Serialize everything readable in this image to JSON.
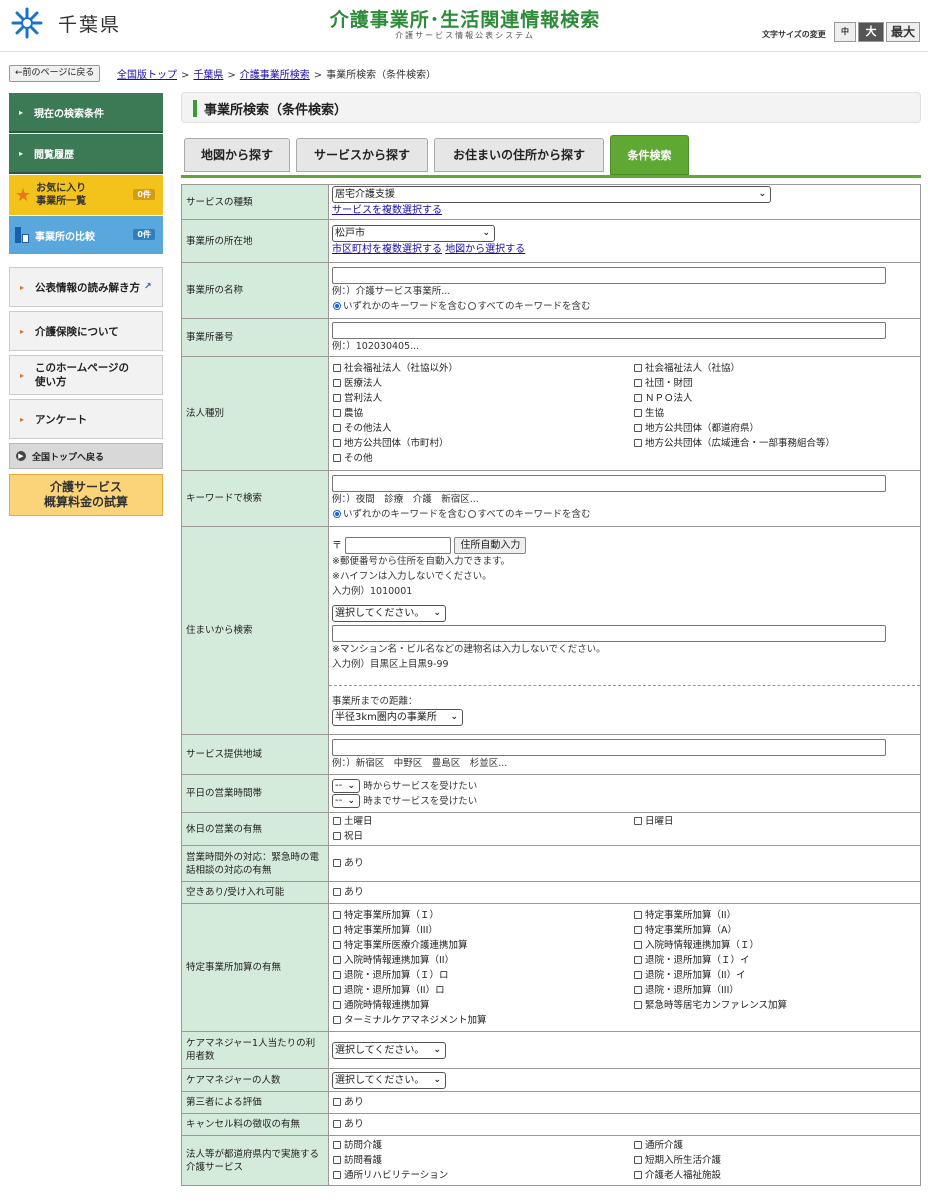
{
  "header": {
    "prefecture": "千葉県",
    "title": "介護事業所･生活関連情報検索",
    "subtitle": "介護サービス情報公表システム",
    "font_size_label": "文字サイズの変更",
    "font_sizes": [
      "中",
      "大",
      "最大"
    ],
    "brand_color": "#2e8b3a",
    "icons": {
      "logo": "chiba-logo-icon"
    }
  },
  "nav": {
    "back_button": "←前のページに戻る",
    "breadcrumb": [
      "全国版トップ",
      "千葉県",
      "介護事業所検索",
      "事業所検索（条件検索）"
    ],
    "separator": ">"
  },
  "sidebar": {
    "current_conditions": "現在の検索条件",
    "history": "閲覧履歴",
    "favorites": {
      "line1": "お気に入り",
      "line2": "事業所一覧",
      "count": "0件"
    },
    "compare": {
      "label": "事業所の比較",
      "count": "0件"
    },
    "links": [
      {
        "label": "公表情報の読み解き方"
      },
      {
        "label": "介護保険について"
      },
      {
        "label1": "このホームページの",
        "label2": "使い方"
      },
      {
        "label": "アンケート"
      }
    ],
    "national_top": "全国トップへ戻る",
    "estimate": {
      "line1": "介護サービス",
      "line2": "概算料金の試算"
    }
  },
  "page_title": "事業所検索（条件検索）",
  "tabs": [
    "地図から探す",
    "サービスから探す",
    "お住まいの住所から探す",
    "条件検索"
  ],
  "active_tab": "条件検索",
  "form": {
    "service_type": {
      "label": "サービスの種類",
      "value": "居宅介護支援",
      "link": "サービスを複数選択する"
    },
    "location": {
      "label": "事業所の所在地",
      "value": "松戸市",
      "link1": "市区町村を複数選択する",
      "link2": "地図から選択する"
    },
    "name": {
      "label": "事業所の名称",
      "example": "例：）介護サービス事業所...",
      "opt_any": "いずれかのキーワードを含む",
      "opt_all": "すべてのキーワードを含む"
    },
    "number": {
      "label": "事業所番号",
      "example": "例：）102030405..."
    },
    "corp_type": {
      "label": "法人種別",
      "left": [
        "社会福祉法人（社協以外）",
        "医療法人",
        "営利法人",
        "農協",
        "その他法人",
        "地方公共団体（市町村）",
        "その他"
      ],
      "right": [
        "社会福祉法人（社協）",
        "社団・財団",
        "ＮＰＯ法人",
        "生協",
        "地方公共団体（都道府県）",
        "地方公共団体（広域連合・一部事務組合等）"
      ]
    },
    "keyword": {
      "label": "キーワードで検索",
      "example": "例：）夜間　診療　介護　新宿区...",
      "opt_any": "いずれかのキーワードを含む",
      "opt_all": "すべてのキーワードを含む"
    },
    "address": {
      "label": "住まいから検索",
      "postal_mark": "〒",
      "auto_button": "住所自動入力",
      "note1": "※郵便番号から住所を自動入力できます。",
      "note2": "※ハイフンは入力しないでください。",
      "example1": "入力例）1010001",
      "select_placeholder": "選択してください。",
      "note3": "※マンション名・ビル名などの建物名は入力しないでください。",
      "example2": "入力例）目黒区上目黒9-99",
      "distance_label": "事業所までの距離：",
      "distance_value": "半径3km圏内の事業所"
    },
    "area": {
      "label": "サービス提供地域",
      "example": "例：）新宿区　中野区　豊島区　杉並区..."
    },
    "weekday_hours": {
      "label": "平日の営業時間帯",
      "from_value": "--",
      "from_text": "時からサービスを受けたい",
      "to_value": "--",
      "to_text": "時までサービスを受けたい"
    },
    "holiday": {
      "label": "休日の営業の有無",
      "sat": "土曜日",
      "sun": "日曜日",
      "hol": "祝日"
    },
    "emergency": {
      "label": "営業時間外の対応：緊急時の電話相談の対応の有無",
      "opt": "あり"
    },
    "vacancy": {
      "label": "空きあり/受け入れ可能",
      "opt": "あり"
    },
    "special_add": {
      "label": "特定事業所加算の有無",
      "left": [
        "特定事業所加算（Ｉ）",
        "特定事業所加算（III）",
        "特定事業所医療介護連携加算",
        "入院時情報連携加算（II）",
        "退院・退所加算（Ｉ）ロ",
        "退院・退所加算（II）ロ",
        "通院時情報連携加算",
        "ターミナルケアマネジメント加算"
      ],
      "right": [
        "特定事業所加算（II）",
        "特定事業所加算（A）",
        "入院時情報連携加算（Ｉ）",
        "退院・退所加算（Ｉ）イ",
        "退院・退所加算（II）イ",
        "退院・退所加算（III）",
        "緊急時等居宅カンファレンス加算"
      ]
    },
    "cm_users": {
      "label": "ケアマネジャー1人当たりの利用者数",
      "value": "選択してください。"
    },
    "cm_count": {
      "label": "ケアマネジャーの人数",
      "value": "選択してください。"
    },
    "third_party": {
      "label": "第三者による評価",
      "opt": "あり"
    },
    "cancel_fee": {
      "label": "キャンセル料の徴収の有無",
      "opt": "あり"
    },
    "corp_services": {
      "label": "法人等が都道府県内で実施する介護サービス",
      "left": [
        "訪問介護",
        "訪問看護",
        "通所リハビリテーション"
      ],
      "right": [
        "通所介護",
        "短期入所生活介護",
        "介護老人福祉施設"
      ]
    }
  }
}
